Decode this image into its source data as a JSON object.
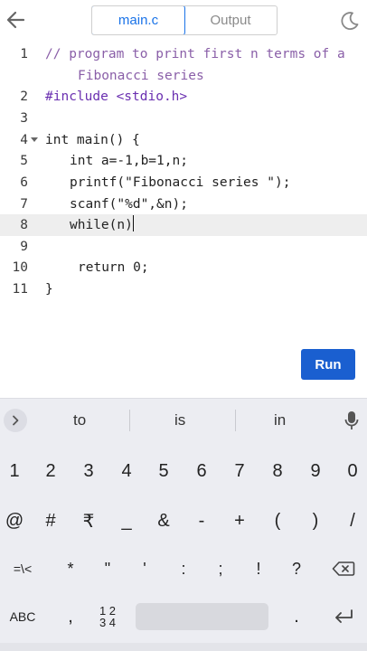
{
  "tabs": [
    {
      "label": "main.c",
      "active": true
    },
    {
      "label": "Output",
      "active": false
    }
  ],
  "editor": {
    "current_line": 8,
    "lines": [
      {
        "num": "1",
        "text": "// program to print first n terms of a"
      },
      {
        "num": "",
        "text": "Fibonacci series"
      },
      {
        "num": "2",
        "text": "#include <stdio.h>"
      },
      {
        "num": "3",
        "text": ""
      },
      {
        "num": "4",
        "text": "int main() {"
      },
      {
        "num": "5",
        "text": "int a=-1,b=1,n;"
      },
      {
        "num": "6",
        "text": "printf(\"Fibonacci series \");"
      },
      {
        "num": "7",
        "text": "scanf(\"%d\",&n);"
      },
      {
        "num": "8",
        "text": "while(n)"
      },
      {
        "num": "9",
        "text": ""
      },
      {
        "num": "10",
        "text": "return 0;"
      },
      {
        "num": "11",
        "text": "}"
      }
    ]
  },
  "run_button": {
    "label": "Run"
  },
  "keyboard": {
    "suggestions": [
      "to",
      "is",
      "in"
    ],
    "row_numbers": [
      "1",
      "2",
      "3",
      "4",
      "5",
      "6",
      "7",
      "8",
      "9",
      "0"
    ],
    "row_symbols1": [
      "@",
      "#",
      "₹",
      "_",
      "&",
      "-",
      "+",
      "(",
      ")",
      "/"
    ],
    "row_symbols2_switch": "=\\<",
    "row_symbols2": [
      "*",
      "\"",
      "'",
      ":",
      ";",
      "!",
      "?"
    ],
    "abc_label": "ABC",
    "comma": ",",
    "numpad_label_top": "1 2",
    "numpad_label_bottom": "3 4",
    "period": "."
  },
  "colors": {
    "accent": "#1a73e8",
    "run_button": "#1a5fd0",
    "comment": "#8a5fa8",
    "keyword": "#6a2fb0",
    "string": "#b03a2e",
    "current_line_bg": "#eeeeee",
    "keyboard_bg": "#ecedf2"
  }
}
